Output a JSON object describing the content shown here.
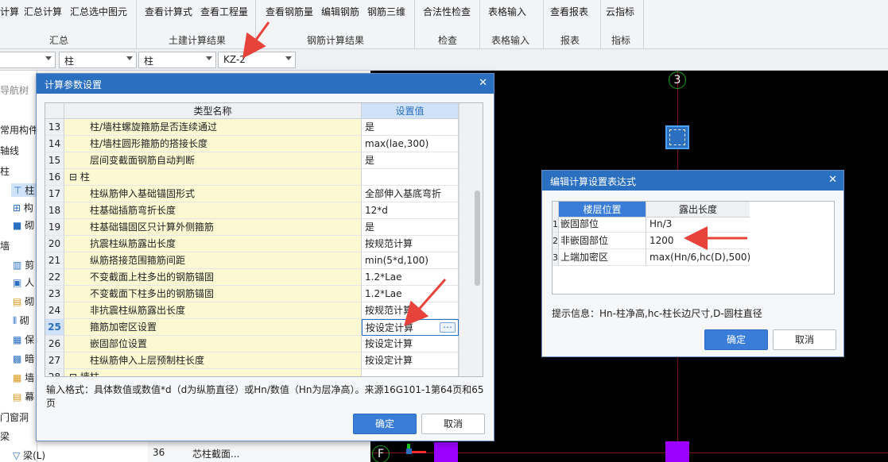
{
  "ribbon": {
    "groups": [
      {
        "buttons": [
          "计算",
          "汇总计算",
          "汇总选中图元"
        ],
        "label": "汇总"
      },
      {
        "buttons": [
          "查看计算式",
          "查看工程量"
        ],
        "label": "土建计算结果"
      },
      {
        "buttons": [
          "查看钢筋量",
          "编辑钢筋",
          "钢筋三维"
        ],
        "label": "钢筋计算结果"
      },
      {
        "buttons": [
          "合法性检查"
        ],
        "label": "检查"
      },
      {
        "buttons": [
          "表格输入"
        ],
        "label": "表格输入"
      },
      {
        "buttons": [
          "查看报表"
        ],
        "label": "报表"
      },
      {
        "buttons": [
          "云指标"
        ],
        "label": "指标"
      }
    ]
  },
  "selectors": {
    "c1": "",
    "c2": "柱",
    "c3": "柱",
    "c4": "KZ-2"
  },
  "tree": {
    "header": "导航树",
    "items": [
      "常用构件类型",
      "轴线",
      "柱",
      "柱",
      "构",
      "砌",
      "墙",
      "剪",
      "人",
      "砌",
      "砌",
      "保",
      "暗",
      "墙",
      "幕",
      "门窗洞",
      "梁",
      "梁(L)"
    ]
  },
  "midpanel": {
    "num": "36",
    "text": "芯柱截面..."
  },
  "axis": {
    "top": "3",
    "bottom": "F"
  },
  "dialog1": {
    "title": "计算参数设置",
    "col_name": "类型名称",
    "col_value": "设置值",
    "rows": [
      {
        "n": "13",
        "name": "柱/墙柱螺旋箍筋是否连续通过",
        "value": "是"
      },
      {
        "n": "14",
        "name": "柱/墙柱圆形箍筋的搭接长度",
        "value": "max(lae,300)"
      },
      {
        "n": "15",
        "name": "层间变截面钢筋自动判断",
        "value": "是"
      },
      {
        "n": "16",
        "name": "柱",
        "value": "",
        "group": true
      },
      {
        "n": "17",
        "name": "柱纵筋伸入基础锚固形式",
        "value": "全部伸入基底弯折"
      },
      {
        "n": "18",
        "name": "柱基础插筋弯折长度",
        "value": "12*d"
      },
      {
        "n": "19",
        "name": "柱基础锚固区只计算外侧箍筋",
        "value": "是"
      },
      {
        "n": "20",
        "name": "抗震柱纵筋露出长度",
        "value": "按规范计算"
      },
      {
        "n": "21",
        "name": "纵筋搭接范围箍筋间距",
        "value": "min(5*d,100)"
      },
      {
        "n": "22",
        "name": "不变截面上柱多出的钢筋锚固",
        "value": "1.2*Lae"
      },
      {
        "n": "23",
        "name": "不变截面下柱多出的钢筋锚固",
        "value": "1.2*Lae"
      },
      {
        "n": "24",
        "name": "非抗震柱纵筋露出长度",
        "value": "按规范计算"
      },
      {
        "n": "25",
        "name": "箍筋加密区设置",
        "value": "按设定计算",
        "selected": true
      },
      {
        "n": "26",
        "name": "嵌固部位设置",
        "value": "按设定计算"
      },
      {
        "n": "27",
        "name": "柱纵筋伸入上层预制柱长度",
        "value": "按设定计算"
      },
      {
        "n": "28",
        "name": "墙柱",
        "value": "",
        "group": true
      }
    ],
    "hint": "输入格式：具体数值或数值*d（d为纵筋直径）或Hn/数值（Hn为层净高）。来源16G101-1第64页和65页",
    "ok": "确定",
    "cancel": "取消"
  },
  "dialog2": {
    "title": "编辑计算设置表达式",
    "col_pos": "楼层位置",
    "col_len": "露出长度",
    "rows": [
      {
        "n": "1",
        "pos": "嵌固部位",
        "len": "Hn/3"
      },
      {
        "n": "2",
        "pos": "非嵌固部位",
        "len": "1200"
      },
      {
        "n": "3",
        "pos": "上端加密区",
        "len": "max(Hn/6,hc(D),500)"
      }
    ],
    "hint": "提示信息：Hn-柱净高,hc-柱长边尺寸,D-圆柱直径",
    "ok": "确定",
    "cancel": "取消"
  },
  "colors": {
    "title_blue": "#2b6fc1",
    "highlight": "#e8433a",
    "canvas": "#000000",
    "magenta": "#9b00ff"
  }
}
